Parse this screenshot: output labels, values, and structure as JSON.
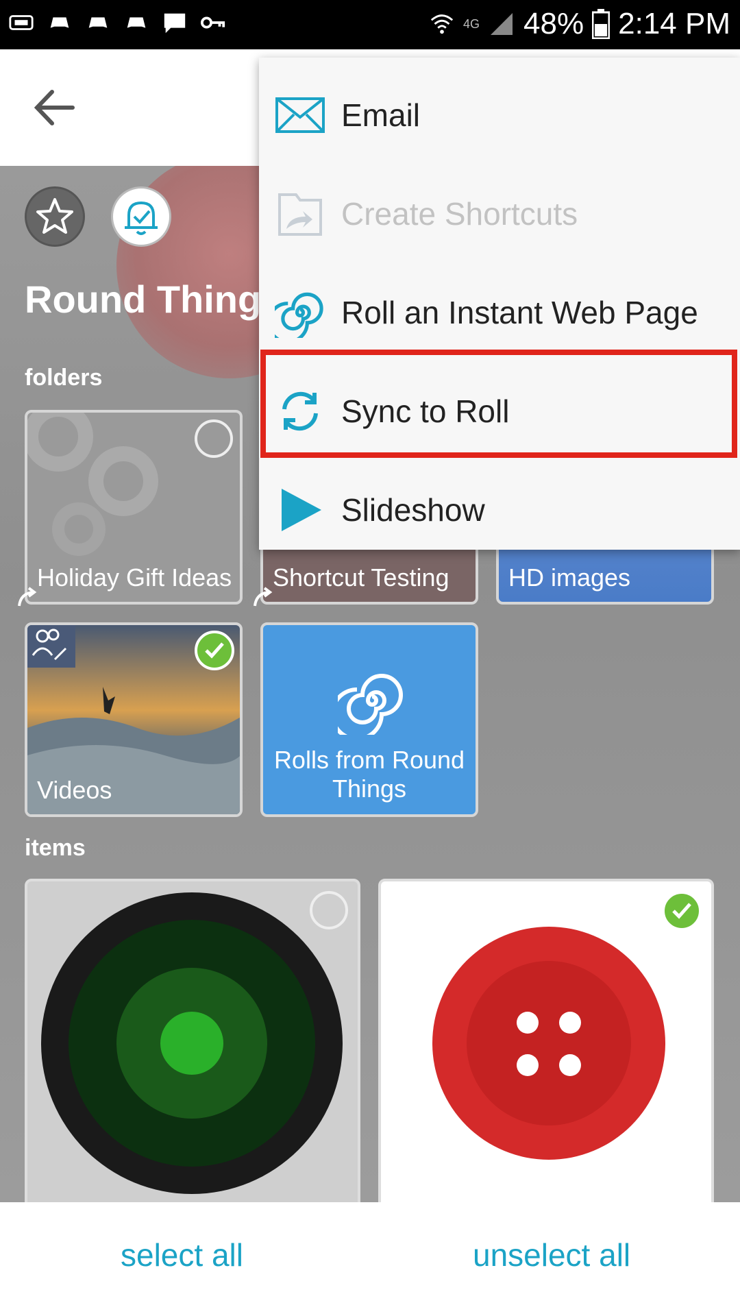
{
  "status_bar": {
    "network": "4G",
    "battery": "48%",
    "time": "2:14 PM"
  },
  "page": {
    "title": "Round Things"
  },
  "sections": {
    "folders_label": "folders",
    "items_label": "items"
  },
  "folders": [
    {
      "label": "Holiday Gift Ideas",
      "selected": false
    },
    {
      "label": "Shortcut Testing"
    },
    {
      "label": "HD images"
    },
    {
      "label": "Videos",
      "selected": true
    },
    {
      "label": "Rolls from Round Things"
    }
  ],
  "items": [
    {
      "name": "green-lens-item",
      "selected": false
    },
    {
      "name": "red-button-item",
      "selected": true
    }
  ],
  "menu": {
    "items": [
      {
        "label": "Email",
        "icon": "envelope-icon",
        "enabled": true
      },
      {
        "label": "Create Shortcuts",
        "icon": "shortcut-folder-icon",
        "enabled": false
      },
      {
        "label": "Roll an Instant Web Page",
        "icon": "spiral-icon",
        "enabled": true
      },
      {
        "label": "Sync to Roll",
        "icon": "sync-icon",
        "enabled": true,
        "highlighted": true
      },
      {
        "label": "Slideshow",
        "icon": "play-icon",
        "enabled": true
      }
    ]
  },
  "bottom_bar": {
    "select_all": "select all",
    "unselect_all": "unselect all"
  },
  "colors": {
    "accent": "#1ba3c6",
    "highlight": "#e0251b",
    "folder_blue": "#4a9ae0",
    "check_green": "#6dbf3a"
  }
}
